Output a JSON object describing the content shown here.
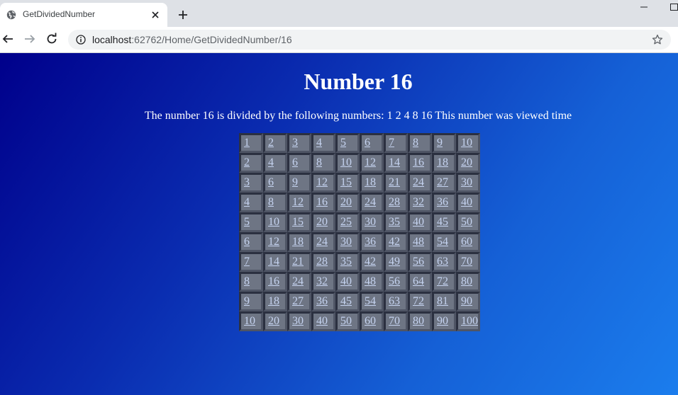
{
  "browser": {
    "tab_title": "GetDividedNumber",
    "url_host": "localhost",
    "url_path": ":62762/Home/GetDividedNumber/16"
  },
  "page": {
    "heading": "Number 16",
    "description": "The number 16 is divided by the following numbers: 1 2 4 8 16 This number was viewed time"
  },
  "table": {
    "rows": [
      [
        "1",
        "2",
        "3",
        "4",
        "5",
        "6",
        "7",
        "8",
        "9",
        "10"
      ],
      [
        "2",
        "4",
        "6",
        "8",
        "10",
        "12",
        "14",
        "16",
        "18",
        "20"
      ],
      [
        "3",
        "6",
        "9",
        "12",
        "15",
        "18",
        "21",
        "24",
        "27",
        "30"
      ],
      [
        "4",
        "8",
        "12",
        "16",
        "20",
        "24",
        "28",
        "32",
        "36",
        "40"
      ],
      [
        "5",
        "10",
        "15",
        "20",
        "25",
        "30",
        "35",
        "40",
        "45",
        "50"
      ],
      [
        "6",
        "12",
        "18",
        "24",
        "30",
        "36",
        "42",
        "48",
        "54",
        "60"
      ],
      [
        "7",
        "14",
        "21",
        "28",
        "35",
        "42",
        "49",
        "56",
        "63",
        "70"
      ],
      [
        "8",
        "16",
        "24",
        "32",
        "40",
        "48",
        "56",
        "64",
        "72",
        "80"
      ],
      [
        "9",
        "18",
        "27",
        "36",
        "45",
        "54",
        "63",
        "72",
        "81",
        "90"
      ],
      [
        "10",
        "20",
        "30",
        "40",
        "50",
        "60",
        "70",
        "80",
        "90",
        "100"
      ]
    ]
  },
  "icons": {
    "tab_favicon": "globe-icon",
    "tab_close": "close-icon",
    "new_tab": "plus-icon",
    "back": "arrow-left-icon",
    "forward": "arrow-right-icon",
    "reload": "reload-icon",
    "site_info": "info-icon",
    "bookmark": "star-icon",
    "minimize": "minimize-icon",
    "maximize": "maximize-icon"
  },
  "colors": {
    "link": "#c5d3f0",
    "cell_bg": "#6e7584",
    "page_gradient_start": "#00008b",
    "page_gradient_end": "#1b7ded"
  }
}
